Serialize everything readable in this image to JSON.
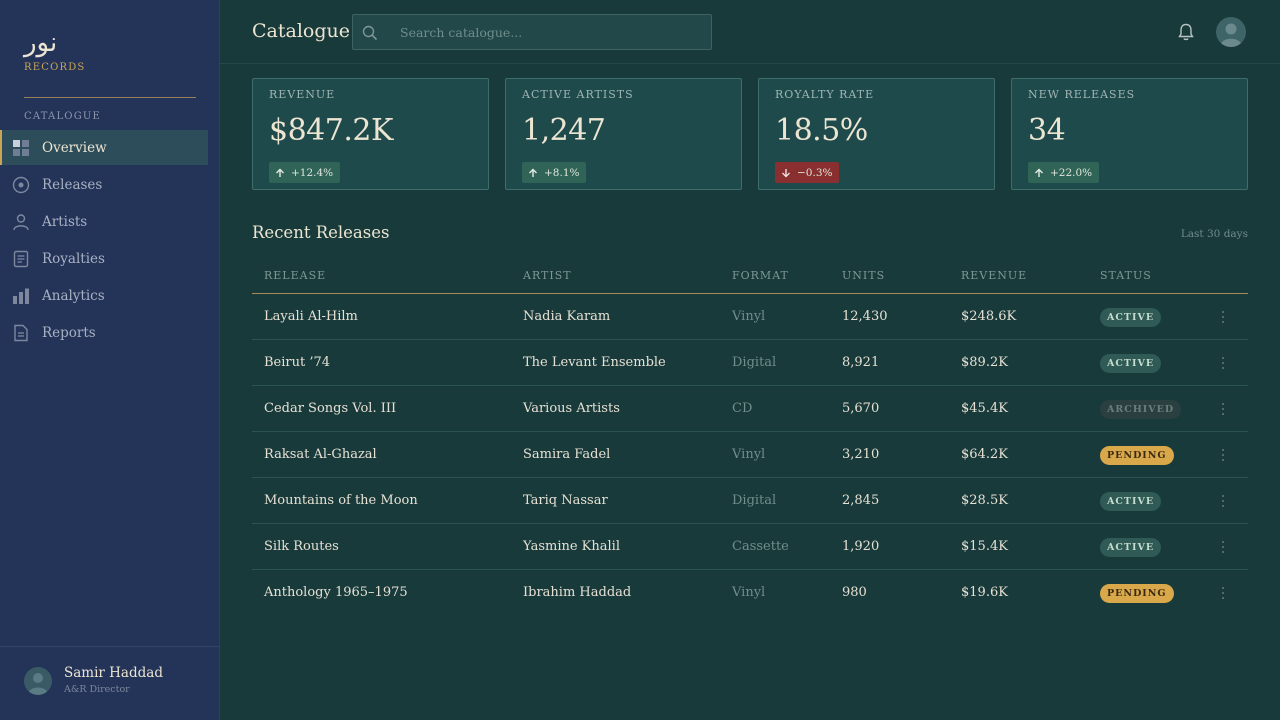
{
  "brand": {
    "arabic": "نور",
    "sub": "RECORDS"
  },
  "sidebar": {
    "section_label": "CATALOGUE",
    "items": [
      {
        "label": "Overview",
        "icon": "grid-icon",
        "active": true
      },
      {
        "label": "Releases",
        "icon": "disc-icon",
        "active": false
      },
      {
        "label": "Artists",
        "icon": "person-icon",
        "active": false
      },
      {
        "label": "Royalties",
        "icon": "ledger-icon",
        "active": false
      },
      {
        "label": "Analytics",
        "icon": "bar-chart-icon",
        "active": false
      },
      {
        "label": "Reports",
        "icon": "document-icon",
        "active": false
      }
    ],
    "user": {
      "name": "Samir Haddad",
      "role": "A&R Director"
    }
  },
  "header": {
    "title": "Catalogue",
    "search_placeholder": "Search catalogue...",
    "search_value": ""
  },
  "stats": [
    {
      "label": "REVENUE",
      "value": "$847.2K",
      "delta": "+12.4%",
      "direction": "up"
    },
    {
      "label": "ACTIVE ARTISTS",
      "value": "1,247",
      "delta": "+8.1%",
      "direction": "up"
    },
    {
      "label": "ROYALTY RATE",
      "value": "18.5%",
      "delta": "−0.3%",
      "direction": "down"
    },
    {
      "label": "NEW RELEASES",
      "value": "34",
      "delta": "+22.0%",
      "direction": "up"
    }
  ],
  "releases": {
    "title": "Recent Releases",
    "period": "Last 30 days",
    "columns": [
      "RELEASE",
      "ARTIST",
      "FORMAT",
      "UNITS",
      "REVENUE",
      "STATUS"
    ],
    "rows": [
      {
        "release": "Layali Al-Hilm",
        "artist": "Nadia Karam",
        "format": "Vinyl",
        "units": "12,430",
        "revenue": "$248.6K",
        "status": "ACTIVE"
      },
      {
        "release": "Beirut ’74",
        "artist": "The Levant Ensemble",
        "format": "Digital",
        "units": "8,921",
        "revenue": "$89.2K",
        "status": "ACTIVE"
      },
      {
        "release": "Cedar Songs Vol. III",
        "artist": "Various Artists",
        "format": "CD",
        "units": "5,670",
        "revenue": "$45.4K",
        "status": "ARCHIVED"
      },
      {
        "release": "Raksat Al-Ghazal",
        "artist": "Samira Fadel",
        "format": "Vinyl",
        "units": "3,210",
        "revenue": "$64.2K",
        "status": "PENDING"
      },
      {
        "release": "Mountains of the Moon",
        "artist": "Tariq Nassar",
        "format": "Digital",
        "units": "2,845",
        "revenue": "$28.5K",
        "status": "ACTIVE"
      },
      {
        "release": "Silk Routes",
        "artist": "Yasmine Khalil",
        "format": "Cassette",
        "units": "1,920",
        "revenue": "$15.4K",
        "status": "ACTIVE"
      },
      {
        "release": "Anthology 1965–1975",
        "artist": "Ibrahim Haddad",
        "format": "Vinyl",
        "units": "980",
        "revenue": "$19.6K",
        "status": "PENDING"
      }
    ]
  },
  "colors": {
    "sidebar": "#243459",
    "main": "#193a3b",
    "accent_gold": "#c9a455",
    "positive": "#2f6457",
    "negative": "#8a2f2f",
    "pending": "#d8a84a"
  }
}
